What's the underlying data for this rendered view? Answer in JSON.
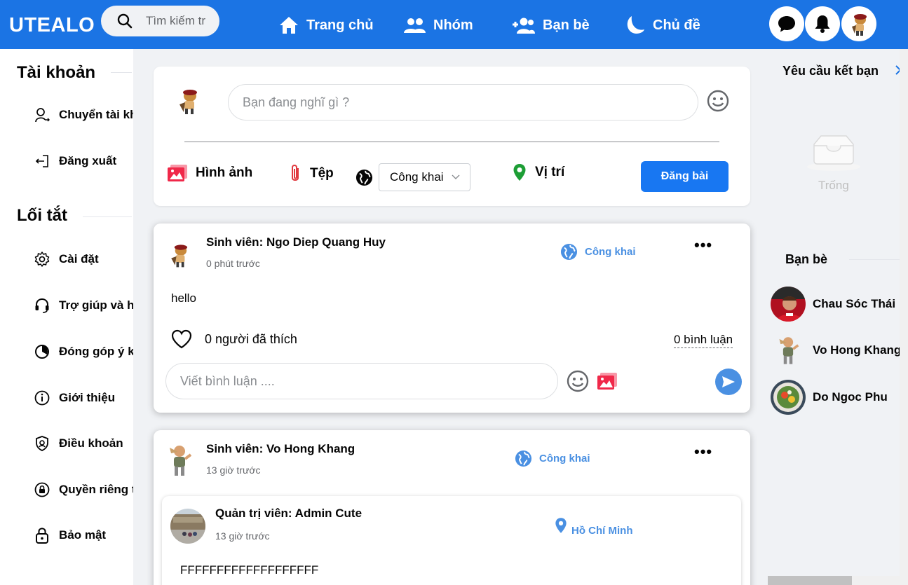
{
  "header": {
    "logo": "UTEALO",
    "search_placeholder": "Tìm kiếm tr",
    "nav": [
      {
        "label": "Trang chủ",
        "icon": "home-icon"
      },
      {
        "label": "Nhóm",
        "icon": "group-icon"
      },
      {
        "label": "Bạn bè",
        "icon": "add-friend-icon"
      },
      {
        "label": "Chủ đề",
        "icon": "theme-moon-icon"
      }
    ],
    "accent": "#1b74e4"
  },
  "sidebar": {
    "account_heading": "Tài khoản",
    "account_items": [
      {
        "label": "Chuyển tài khoản",
        "icon": "switch-account-icon"
      },
      {
        "label": "Đăng xuất",
        "icon": "logout-icon"
      }
    ],
    "shortcuts_heading": "Lối tắt",
    "shortcut_items": [
      {
        "label": "Cài đặt",
        "icon": "gear-icon"
      },
      {
        "label": "Trợ giúp và hỗ trợ",
        "icon": "headset-icon"
      },
      {
        "label": "Đóng góp ý kiến",
        "icon": "feedback-icon"
      },
      {
        "label": "Giới thiệu",
        "icon": "info-icon"
      },
      {
        "label": "Điều khoản",
        "icon": "shield-icon"
      },
      {
        "label": "Quyền riêng tư",
        "icon": "privacy-lock-icon"
      },
      {
        "label": "Bảo mật",
        "icon": "lock-icon"
      }
    ]
  },
  "composer": {
    "placeholder": "Bạn đang nghĩ gì ?",
    "image_label": "Hình ảnh",
    "file_label": "Tệp",
    "privacy_value": "Công khai",
    "location_label": "Vị trí",
    "post_button": "Đăng bài"
  },
  "posts": [
    {
      "author": "Sinh viên: Ngo Diep Quang Huy",
      "time": "0 phút trước",
      "visibility": "Công khai",
      "content": "hello",
      "likes": "0 người đã thích",
      "comments": "0 bình luận",
      "comment_placeholder": "Viết bình luận ...."
    },
    {
      "author": "Sinh viên: Vo Hong Khang",
      "time": "13 giờ trước",
      "visibility": "Công khai",
      "shared": {
        "author": "Quản trị viên: Admin Cute",
        "time": "13 giờ trước",
        "location": "Hồ Chí Minh",
        "content": "FFFFFFFFFFFFFFFFFFF"
      }
    }
  ],
  "right": {
    "requests_title": "Yêu cầu kết bạn",
    "empty_text": "Trống",
    "friends_title": "Bạn bè",
    "friends": [
      {
        "name": "Chau Sóc Thái"
      },
      {
        "name": "Vo Hong Khang"
      },
      {
        "name": "Do Ngoc Phu"
      }
    ]
  }
}
